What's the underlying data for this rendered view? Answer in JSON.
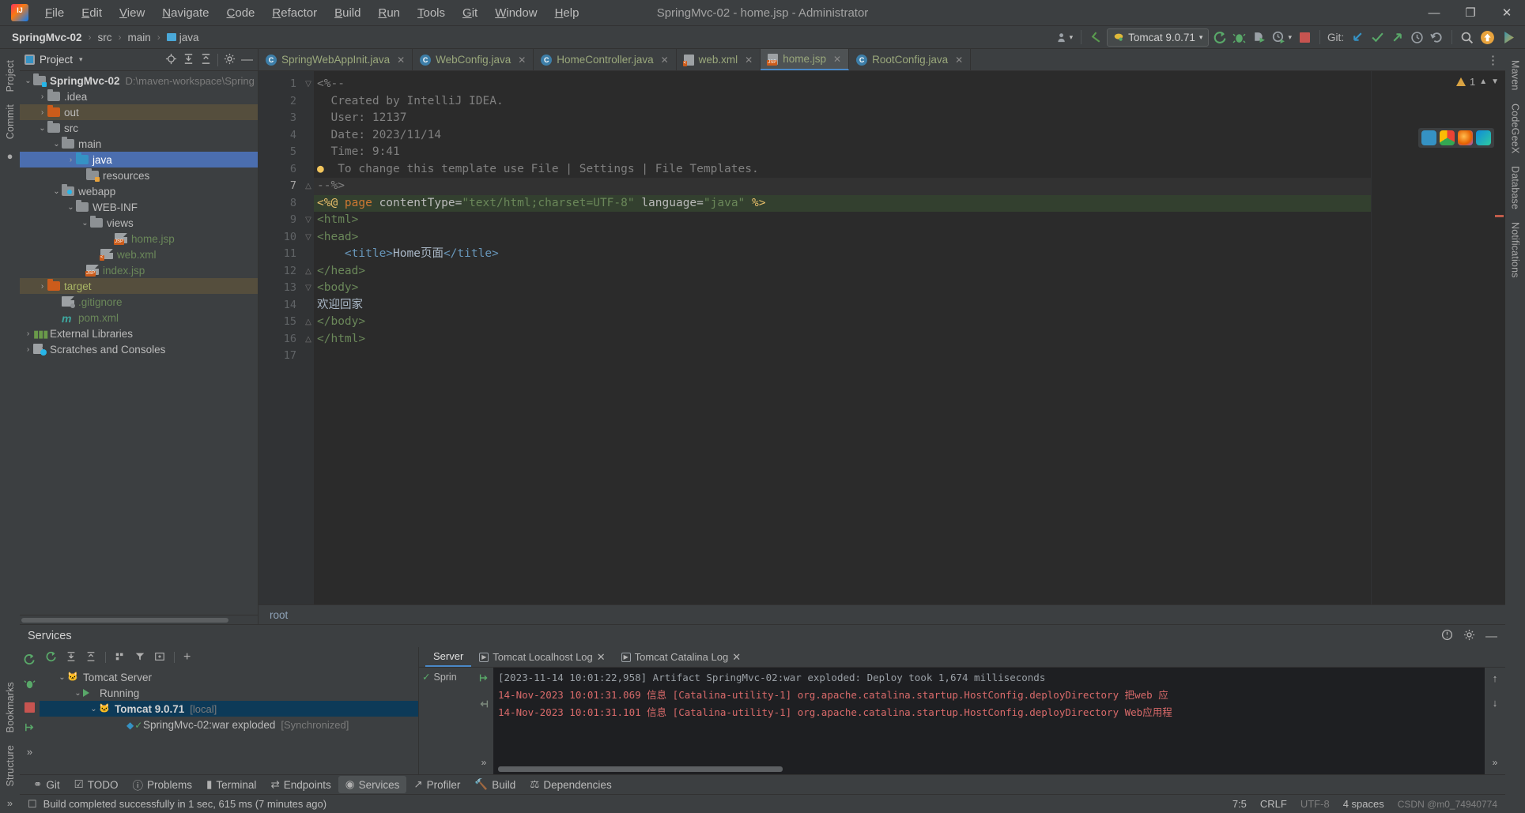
{
  "window": {
    "title": "SpringMvc-02 - home.jsp - Administrator",
    "minimize": "—",
    "maximize": "❐",
    "close": "✕"
  },
  "menu": [
    "File",
    "Edit",
    "View",
    "Navigate",
    "Code",
    "Refactor",
    "Build",
    "Run",
    "Tools",
    "Git",
    "Window",
    "Help"
  ],
  "breadcrumb": {
    "items": [
      "SpringMvc-02",
      "src",
      "main",
      "java"
    ],
    "separator": "›"
  },
  "toolbar": {
    "run_config": "Tomcat 9.0.71",
    "git_label": "Git:",
    "dropdown_caret": "▾",
    "icons": {
      "user": "user-icon",
      "back_arrow": "back-arrow-icon",
      "run": "run-icon",
      "debug": "debug-icon",
      "run_coverage": "run-with-coverage-icon",
      "profiler": "profiler-icon",
      "stop": "stop-icon",
      "update": "update-project-icon",
      "commit": "commit-icon",
      "push": "push-icon",
      "history": "history-icon",
      "rollback": "rollback-icon",
      "search": "search-icon",
      "updates": "updates-available-icon",
      "ide": "ide-icon"
    }
  },
  "left_rail": [
    "Project",
    "Commit"
  ],
  "right_rail": [
    "Maven",
    "CodeGeeX",
    "Database",
    "Notifications"
  ],
  "project_panel": {
    "title": "Project",
    "caret": "▾",
    "header_icons": [
      "locate-icon",
      "expand-all-icon",
      "collapse-all-icon",
      "settings-icon",
      "hide-icon"
    ],
    "tree": [
      {
        "indent": 0,
        "arrow": "⌄",
        "icon": "module-folder",
        "label": "SpringMvc-02",
        "bold": true,
        "sub": "D:\\maven-workspace\\Spring"
      },
      {
        "indent": 1,
        "arrow": "›",
        "icon": "folder-gray",
        "label": ".idea"
      },
      {
        "indent": 1,
        "arrow": "›",
        "icon": "folder-orange",
        "label": "out",
        "highlight": true
      },
      {
        "indent": 1,
        "arrow": "⌄",
        "icon": "folder-gray",
        "label": "src"
      },
      {
        "indent": 2,
        "arrow": "⌄",
        "icon": "folder-gray",
        "label": "main"
      },
      {
        "indent": 3,
        "arrow": "›",
        "icon": "folder-blue",
        "label": "java",
        "selected": true
      },
      {
        "indent": 3,
        "arrow": "",
        "icon": "folder-resources",
        "label": "resources"
      },
      {
        "indent": 2,
        "arrow": "⌄",
        "icon": "folder-webapp",
        "label": "webapp"
      },
      {
        "indent": 3,
        "arrow": "⌄",
        "icon": "folder-gray",
        "label": "WEB-INF"
      },
      {
        "indent": 4,
        "arrow": "⌄",
        "icon": "folder-gray",
        "label": "views"
      },
      {
        "indent": 5,
        "arrow": "",
        "icon": "jsp-file",
        "label": "home.jsp",
        "color": "green"
      },
      {
        "indent": 4,
        "arrow": "",
        "icon": "xml-file",
        "label": "web.xml",
        "color": "green"
      },
      {
        "indent": 3,
        "arrow": "",
        "icon": "jsp-file",
        "label": "index.jsp",
        "color": "green"
      },
      {
        "indent": 1,
        "arrow": "›",
        "icon": "folder-orange",
        "label": "target",
        "color": "olive",
        "highlight": true
      },
      {
        "indent": 2,
        "arrow": "",
        "icon": "gitignore-file",
        "label": ".gitignore",
        "color": "green"
      },
      {
        "indent": 2,
        "arrow": "",
        "icon": "maven-file",
        "label": "pom.xml",
        "color": "green"
      },
      {
        "indent": 0,
        "arrow": "›",
        "icon": "libraries-icon",
        "label": "External Libraries"
      },
      {
        "indent": 0,
        "arrow": "›",
        "icon": "scratches-icon",
        "label": "Scratches and Consoles"
      }
    ]
  },
  "editor": {
    "tabs": [
      {
        "label": "SpringWebAppInit.java",
        "icon": "class-icon",
        "active": false,
        "close": "✕"
      },
      {
        "label": "WebConfig.java",
        "icon": "class-icon",
        "active": false,
        "close": "✕"
      },
      {
        "label": "HomeController.java",
        "icon": "class-icon",
        "active": false,
        "close": "✕"
      },
      {
        "label": "web.xml",
        "icon": "xml-icon",
        "active": false,
        "close": "✕"
      },
      {
        "label": "home.jsp",
        "icon": "jsp-icon",
        "active": true,
        "close": "✕"
      },
      {
        "label": "RootConfig.java",
        "icon": "class-icon",
        "active": false,
        "close": "✕"
      }
    ],
    "line_numbers": [
      "1",
      "2",
      "3",
      "4",
      "5",
      "6",
      "7",
      "8",
      "9",
      "10",
      "11",
      "12",
      "13",
      "14",
      "15",
      "16",
      "17"
    ],
    "current_line": 7,
    "lines": [
      "<%--",
      "  Created by IntelliJ IDEA.",
      "  User: 12137",
      "  Date: 2023/11/14",
      "  Time: 9:41",
      "  To change this template use File | Settings | File Templates.",
      "--%>",
      "<%@ page contentType=\"text/html;charset=UTF-8\" language=\"java\" %>",
      "<html>",
      "<head>",
      "    <title>Home页面</title>",
      "</head>",
      "<body>",
      "欢迎回家",
      "</body>",
      "</html>",
      ""
    ],
    "warning_count": "1",
    "breadcrumb_bottom": "root"
  },
  "services": {
    "title": "Services",
    "header_icons": [
      "help-icon",
      "settings-icon",
      "hide-icon"
    ],
    "toolbar_icons": [
      "rerun-icon",
      "expand-all-icon",
      "collapse-all-icon",
      "group-icon",
      "filter-icon",
      "show-config-icon",
      "add-icon"
    ],
    "rail_icons": [
      "rerun-icon",
      "debug-icon",
      "stop-icon",
      "exit-icon",
      "more-icon"
    ],
    "tree": [
      {
        "indent": 0,
        "arrow": "⌄",
        "icon": "tomcat-icon",
        "label": "Tomcat Server"
      },
      {
        "indent": 1,
        "arrow": "⌄",
        "icon": "running-icon",
        "label": "Running"
      },
      {
        "indent": 2,
        "arrow": "⌄",
        "icon": "tomcat-icon",
        "label": "Tomcat 9.0.71",
        "bold": true,
        "sub": "[local]",
        "selected": true
      },
      {
        "indent": 3,
        "arrow": "",
        "icon": "artifact-icon",
        "label": "SpringMvc-02:war exploded",
        "sub": "[Synchronized]"
      }
    ],
    "tabs": [
      {
        "label": "Server",
        "active": true,
        "close": ""
      },
      {
        "label": "Tomcat Localhost Log",
        "active": false,
        "close": "✕"
      },
      {
        "label": "Tomcat Catalina Log",
        "active": false,
        "close": "✕"
      }
    ],
    "side_status": "Sprin",
    "console_lines": [
      {
        "text": "[2023-11-14 10:01:22,958] Artifact SpringMvc-02:war exploded: Deploy took 1,674 milliseconds",
        "color": "gray"
      },
      {
        "text": "14-Nov-2023 10:01:31.069 信息 [Catalina-utility-1] org.apache.catalina.startup.HostConfig.deployDirectory 把web 应",
        "color": "red"
      },
      {
        "text": "14-Nov-2023 10:01:31.101 信息 [Catalina-utility-1] org.apache.catalina.startup.HostConfig.deployDirectory Web应用程",
        "color": "red"
      }
    ]
  },
  "tool_windows": [
    {
      "label": "Git",
      "icon": "git-icon",
      "active": false
    },
    {
      "label": "TODO",
      "icon": "todo-icon",
      "active": false
    },
    {
      "label": "Problems",
      "icon": "problems-icon",
      "active": false
    },
    {
      "label": "Terminal",
      "icon": "terminal-icon",
      "active": false
    },
    {
      "label": "Endpoints",
      "icon": "endpoints-icon",
      "active": false
    },
    {
      "label": "Services",
      "icon": "services-icon",
      "active": true
    },
    {
      "label": "Profiler",
      "icon": "profiler-icon",
      "active": false
    },
    {
      "label": "Build",
      "icon": "build-icon",
      "active": false
    },
    {
      "label": "Dependencies",
      "icon": "dependencies-icon",
      "active": false
    }
  ],
  "status_bar": {
    "message": "Build completed successfully in 1 sec, 615 ms (7 minutes ago)",
    "caret_position": "7:5",
    "line_separator": "CRLF",
    "encoding": "UTF-8",
    "indent": "4 spaces",
    "watermark": "CSDN @m0_74940774"
  },
  "colors": {
    "accent_blue": "#4b6eaf",
    "selection_dark": "#0d3a58",
    "bg_panel": "#3c3f41",
    "bg_editor": "#2b2b2b",
    "bg_console": "#1e1f22",
    "green": "#6a8759",
    "orange": "#cc7832",
    "warning": "#d9a343",
    "error_red": "#d96a6a"
  }
}
